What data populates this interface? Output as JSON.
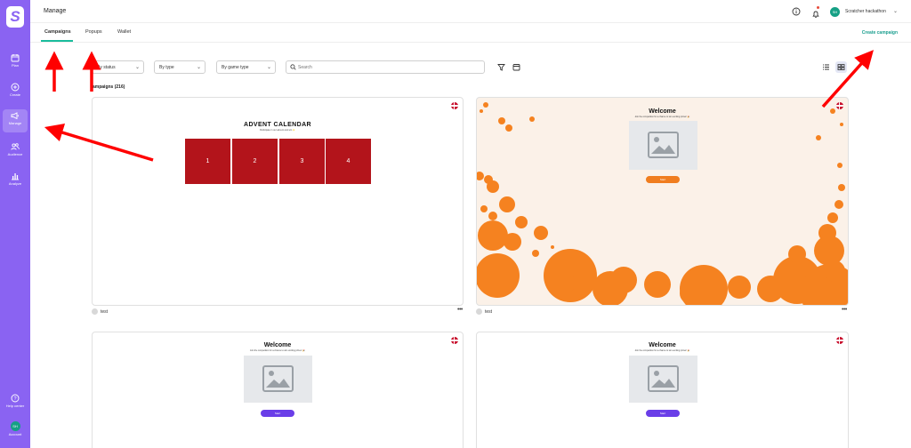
{
  "sidebar": {
    "logo": "S",
    "items": [
      {
        "label": "Plan",
        "icon": "calendar-icon"
      },
      {
        "label": "Create",
        "icon": "plus-circle-icon"
      },
      {
        "label": "Manage",
        "icon": "megaphone-icon"
      },
      {
        "label": "Audience",
        "icon": "users-icon"
      },
      {
        "label": "Analyze",
        "icon": "bar-chart-icon"
      }
    ],
    "help_label": "Help center",
    "account_label": "Account",
    "account_initials": "SH"
  },
  "header": {
    "title": "Manage",
    "user_initials": "SH",
    "user_name": "Scratcher hackathon"
  },
  "tabs": [
    {
      "label": "Campaigns"
    },
    {
      "label": "Popups"
    },
    {
      "label": "Wallet"
    }
  ],
  "create_campaign_label": "Create campaign",
  "filters": {
    "status": "By status",
    "type": "By type",
    "game_type": "By game type",
    "search_placeholder": "Search"
  },
  "list": {
    "count_label": "ampaigns (216)"
  },
  "cards": [
    {
      "kind": "advent",
      "title": "ADVENT CALENDAR",
      "subtitle": "Participate in our advent and win ✨",
      "doors": [
        "1",
        "2",
        "3",
        "4"
      ],
      "name": "test"
    },
    {
      "kind": "welcome",
      "title": "Welcome",
      "subtitle": "Join the competition for a chance to win exciting prizes! 🎉",
      "button": "Start",
      "button_color": "#f07d1f",
      "background": "#fbf1e8",
      "name": "test"
    },
    {
      "kind": "welcome",
      "title": "Welcome",
      "subtitle": "Join the competition for a chance to win exciting prizes! 🎉",
      "button": "Start",
      "button_color": "#6a3ee8"
    },
    {
      "kind": "welcome",
      "title": "Welcome",
      "subtitle": "Join the competition for a chance to win exciting prizes! 🎉",
      "button": "Start",
      "button_color": "#6a3ee8"
    }
  ],
  "colors": {
    "sidebar": "#8a63f2",
    "accent": "#1abc9c",
    "annotation_arrow": "#ff0000",
    "advent_door": "#b3141b",
    "bubble": "#f58220"
  }
}
